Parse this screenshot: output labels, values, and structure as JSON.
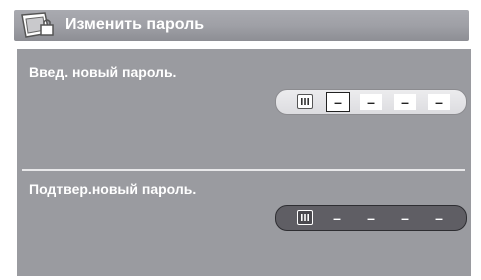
{
  "dialog": {
    "title": "Изменить пароль",
    "title_icon": "keyboard-lock-icon"
  },
  "new_password": {
    "label": "Введ. новый пароль.",
    "digits": [
      "–",
      "–",
      "–",
      "–"
    ],
    "active_index": 0,
    "input_icon": "keyboard-icon"
  },
  "confirm_password": {
    "label": "Подтвер.новый пароль.",
    "digits": [
      "–",
      "–",
      "–",
      "–"
    ],
    "input_icon": "keyboard-icon"
  },
  "colors": {
    "title_bar": "#9fa0a6",
    "panel": "#9a9ba0",
    "pill_light": "#e4e4e8",
    "pill_dark": "#5f5e64"
  }
}
